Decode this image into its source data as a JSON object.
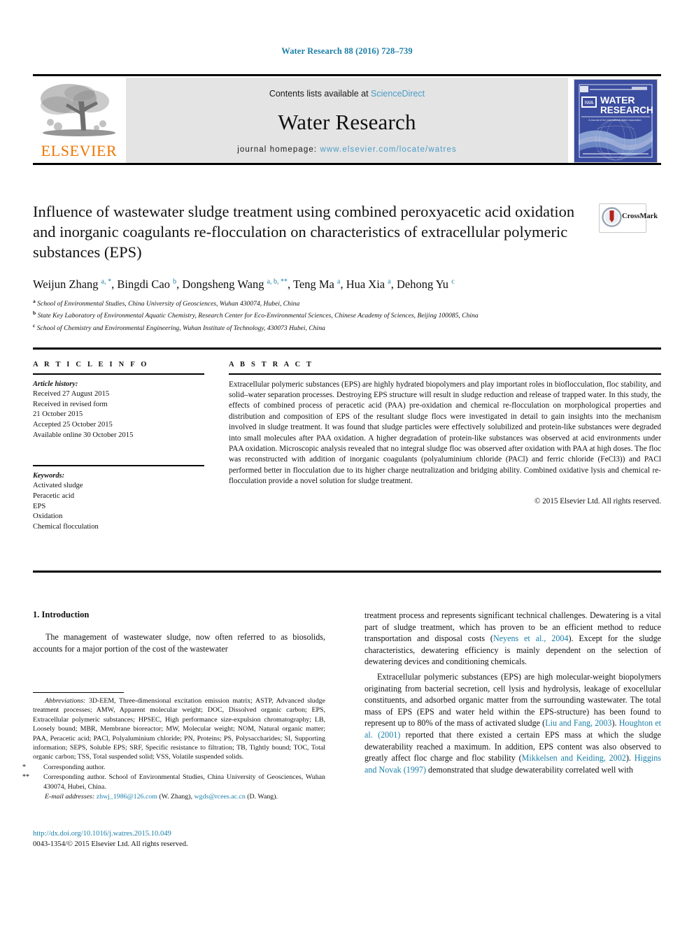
{
  "running_head": "Water Research 88 (2016) 728–739",
  "masthead": {
    "publisher_name": "ELSEVIER",
    "contents_prefix": "Contents lists available at ",
    "contents_link": "ScienceDirect",
    "journal_name": "Water Research",
    "homepage_prefix": "journal homepage: ",
    "homepage_link": "www.elsevier.com/locate/watres",
    "cover_title_line1": "WATER",
    "cover_title_line2": "RESEARCH",
    "cover_iwa": "IWA",
    "cover_subtitle": "A Journal of the International Water Association"
  },
  "article": {
    "title": "Influence of wastewater sludge treatment using combined peroxyacetic acid oxidation and inorganic coagulants re-flocculation on characteristics of extracellular polymeric substances (EPS)",
    "crossmark_label": "CrossMark",
    "authors": [
      {
        "name": "Weijun Zhang",
        "marks": "a, *",
        "sep": ", "
      },
      {
        "name": "Bingdi Cao",
        "marks": "b",
        "sep": ", "
      },
      {
        "name": "Dongsheng Wang",
        "marks": "a, b, **",
        "sep": ", "
      },
      {
        "name": "Teng Ma",
        "marks": "a",
        "sep": ", "
      },
      {
        "name": "Hua Xia",
        "marks": "a",
        "sep": ", "
      },
      {
        "name": "Dehong Yu",
        "marks": "c",
        "sep": ""
      }
    ],
    "affiliations": [
      {
        "mark": "a",
        "text": "School of Environmental Studies, China University of Geosciences, Wuhan 430074, Hubei, China"
      },
      {
        "mark": "b",
        "text": "State Key Laboratory of Environmental Aquatic Chemistry, Research Center for Eco-Environmental Sciences, Chinese Academy of Sciences, Beijing 100085, China"
      },
      {
        "mark": "c",
        "text": "School of Chemistry and Environmental Engineering, Wuhan Institute of Technology, 430073 Hubei, China"
      }
    ]
  },
  "article_info": {
    "heading": "A R T I C L E   I N F O",
    "history_label": "Article history:",
    "history": [
      "Received 27 August 2015",
      "Received in revised form",
      "21 October 2015",
      "Accepted 25 October 2015",
      "Available online 30 October 2015"
    ],
    "keywords_label": "Keywords:",
    "keywords": [
      "Activated sludge",
      "Peracetic acid",
      "EPS",
      "Oxidation",
      "Chemical flocculation"
    ]
  },
  "abstract": {
    "heading": "A B S T R A C T",
    "text": "Extracellular polymeric substances (EPS) are highly hydrated biopolymers and play important roles in bioflocculation, floc stability, and solid–water separation processes. Destroying EPS structure will result in sludge reduction and release of trapped water. In this study, the effects of combined process of peracetic acid (PAA) pre-oxidation and chemical re-flocculation on morphological properties and distribution and composition of EPS of the resultant sludge flocs were investigated in detail to gain insights into the mechanism involved in sludge treatment. It was found that sludge particles were effectively solubilized and protein-like substances were degraded into small molecules after PAA oxidation. A higher degradation of protein-like substances was observed at acid environments under PAA oxidation. Microscopic analysis revealed that no integral sludge floc was observed after oxidation with PAA at high doses. The floc was reconstructed with addition of inorganic coagulants (polyaluminium chloride (PACl) and ferric chloride (FeCl3)) and PACl performed better in flocculation due to its higher charge neutralization and bridging ability. Combined oxidative lysis and chemical re-flocculation provide a novel solution for sludge treatment.",
    "copyright": "© 2015 Elsevier Ltd. All rights reserved."
  },
  "introduction": {
    "heading": "1.  Introduction",
    "left_paragraph": "The management of wastewater sludge, now often referred to as biosolids, accounts for a major portion of the cost of the wastewater",
    "right_paragraph_1_a": "treatment process and represents significant technical challenges. Dewatering is a vital part of sludge treatment, which has proven to be an efficient method to reduce transportation and disposal costs (",
    "right_cite_1": "Neyens et al., 2004",
    "right_paragraph_1_b": "). Except for the sludge characteristics, dewatering efficiency is mainly dependent on the selection of dewatering devices and conditioning chemicals.",
    "right_paragraph_2_a": "Extracellular polymeric substances (EPS) are high molecular-weight biopolymers originating from bacterial secretion, cell lysis and hydrolysis, leakage of exocellular constituents, and adsorbed organic matter from the surrounding wastewater. The total mass of EPS (EPS and water held within the EPS-structure) has been found to represent up to 80% of the mass of activated sludge (",
    "right_cite_2": "Liu and Fang, 2003",
    "right_paragraph_2_b": "). ",
    "right_cite_3": "Houghton et al. (2001)",
    "right_paragraph_2_c": " reported that there existed a certain EPS mass at which the sludge dewaterability reached a maximum. In addition, EPS content was also observed to greatly affect floc charge and floc stability (",
    "right_cite_4": "Mikkelsen and Keiding, 2002",
    "right_paragraph_2_d": "). ",
    "right_cite_5": "Higgins and Novak (1997)",
    "right_paragraph_2_e": " demonstrated that sludge dewaterability correlated well with"
  },
  "footnotes": {
    "abbrev_label": "Abbreviations:",
    "abbrev_text": " 3D-EEM, Three-dimensional excitation emission matrix; ASTP, Advanced sludge treatment processes; AMW, Apparent molecular weight; DOC, Dissolved organic carbon; EPS, Extracellular polymeric substances; HPSEC, High performance size-expulsion chromatography; LB, Loosely bound; MBR, Membrane bioreactor; MW, Molecular weight; NOM, Natural organic matter; PAA, Peracetic acid; PACl, Polyaluminium chloride; PN, Proteins; PS, Polysaccharides; SI, Supporting information; SEPS, Soluble EPS; SRF, Specific resistance to filtration; TB, Tightly bound; TOC, Total organic carbon; TSS, Total suspended solid; VSS, Volatile suspended solids.",
    "corr1_mark": "*",
    "corr1_text": "Corresponding author.",
    "corr2_mark": "**",
    "corr2_text": "Corresponding author. School of Environmental Studies, China University of Geosciences, Wuhan 430074, Hubei, China.",
    "email_label": "E-mail addresses:",
    "email1": "zhwj_1986@126.com",
    "email1_owner": " (W. Zhang), ",
    "email2": "wgds@rcees.ac.cn",
    "email2_owner": " (D. Wang)."
  },
  "imprint": {
    "doi": "http://dx.doi.org/10.1016/j.watres.2015.10.049",
    "issn_line": "0043-1354/© 2015 Elsevier Ltd. All rights reserved."
  },
  "colors": {
    "link_blue": "#1b7fa8",
    "sd_blue": "#4a9cc7",
    "elsevier_orange": "#ee7600",
    "cover_blue": "#3b4da0",
    "band_gray": "#e4e4e4"
  }
}
